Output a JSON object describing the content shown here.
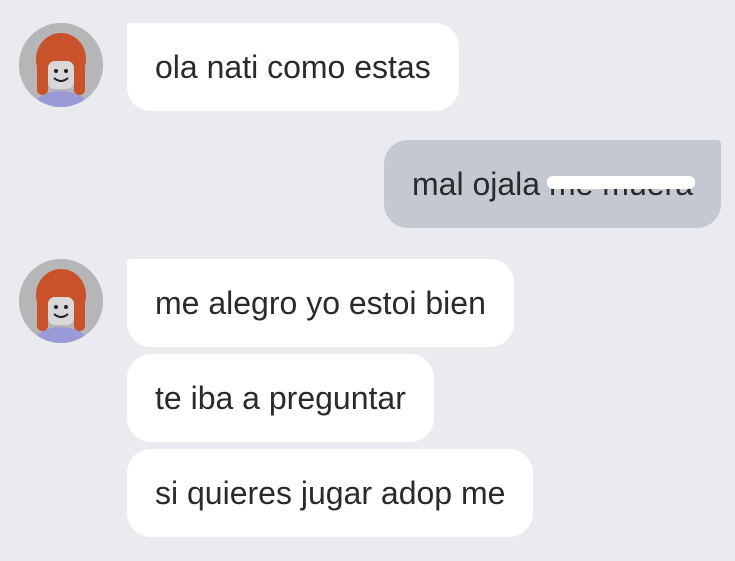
{
  "conversation": {
    "messages": [
      {
        "sender": "contact",
        "text": "ola nati como estas"
      },
      {
        "sender": "me",
        "text": "mal ojala",
        "redacted_text": "me muera"
      },
      {
        "sender": "contact",
        "text": "me alegro yo estoi bien"
      },
      {
        "sender": "contact",
        "text": "te iba a preguntar"
      },
      {
        "sender": "contact",
        "text": "si quieres jugar adop me"
      }
    ]
  },
  "contact": {
    "avatar_icon": "roblox-avatar-icon"
  },
  "theme": {
    "background": "#e9ebee",
    "incoming_bubble": "#ffffff",
    "outgoing_bubble": "#c4c8d0",
    "text": "#2a2a2a",
    "avatar_hair": "#c9522a"
  }
}
